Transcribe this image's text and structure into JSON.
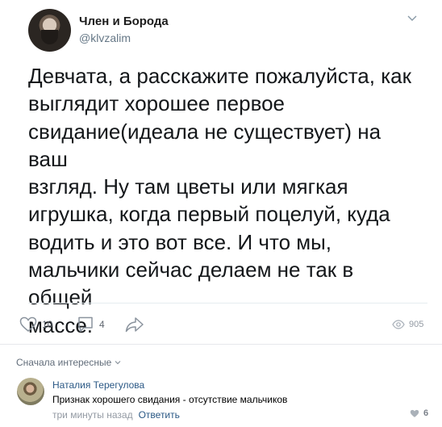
{
  "tweet": {
    "author_name": "Член и Борода",
    "author_handle": "@klvzalim",
    "text": "Девчата, а расскажите пожалуйста, как\nвыглядит хорошее первое\nсвидание(идеала не существует) на ваш\nвзгляд. Ну там цветы или мягкая\nигрушка, когда первый поцелуй, куда\nводить и это вот все. И что мы,\nмальчики сейчас делаем не так в общей\nмассе."
  },
  "actions": {
    "likes": "10",
    "comments": "4",
    "views": "905"
  },
  "comments_section": {
    "sort_label": "Сначала интересные",
    "items": [
      {
        "author": "Наталия Терегулова",
        "text": "Признак хорошего свидания - отсутствие мальчиков",
        "time": "три минуты назад",
        "reply_label": "Ответить",
        "likes": "6"
      }
    ]
  },
  "icons": [
    "chevron-down-icon",
    "heart-icon",
    "comment-icon",
    "share-icon",
    "eye-icon"
  ],
  "colors": {
    "link": "#2a5885",
    "muted": "#939aa3"
  }
}
